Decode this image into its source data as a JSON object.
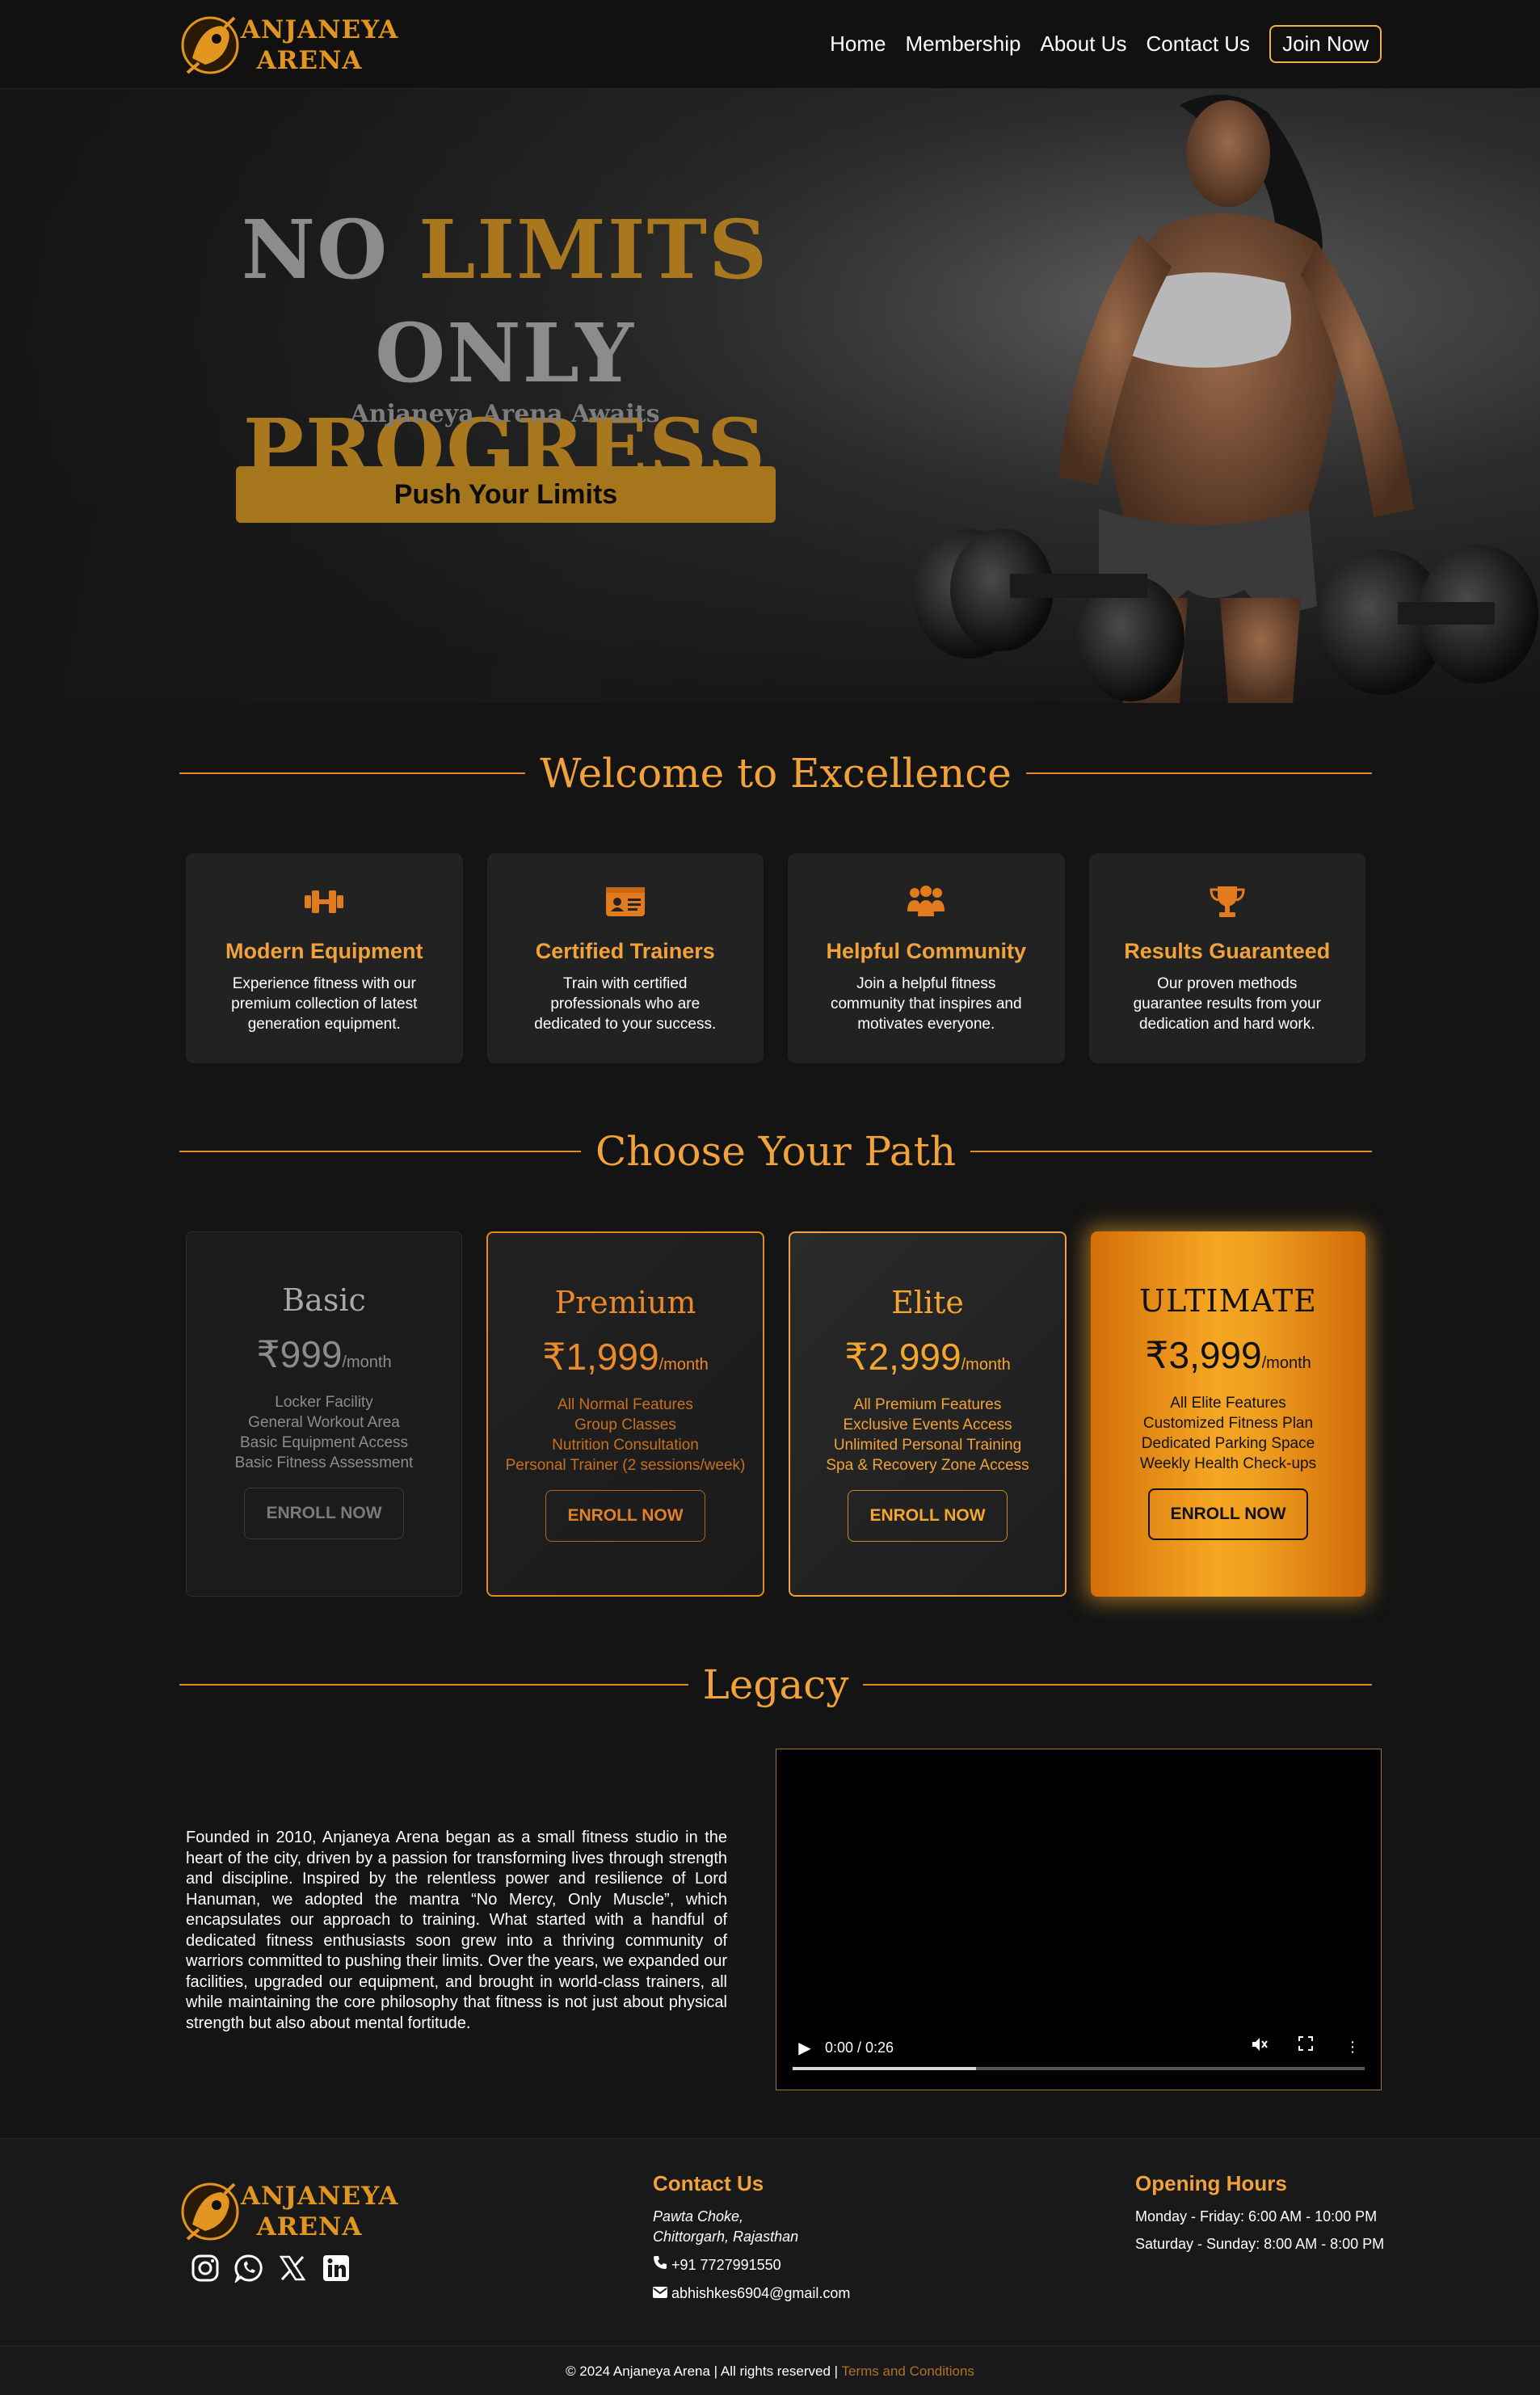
{
  "brand": {
    "line1": "ANJANEYA",
    "line2": "ARENA"
  },
  "nav": {
    "links": [
      "Home",
      "Membership",
      "About Us",
      "Contact Us"
    ],
    "cta": "Join Now"
  },
  "hero": {
    "line1_a": "NO",
    "line1_b": "LIMITS",
    "line2_a": "ONLY",
    "line2_b": "PROGRESS",
    "subtitle": "Anjaneya Arena Awaits",
    "button": "Push Your Limits"
  },
  "welcome": {
    "heading": "Welcome to Excellence",
    "features": [
      {
        "icon": "dumbbell-icon",
        "title": "Modern Equipment",
        "desc": "Experience fitness with our premium collection of latest generation equipment."
      },
      {
        "icon": "id-card-icon",
        "title": "Certified Trainers",
        "desc": "Train with certified professionals who are dedicated to your success."
      },
      {
        "icon": "people-group-icon",
        "title": "Helpful Community",
        "desc": "Join a helpful fitness community that inspires and motivates everyone."
      },
      {
        "icon": "trophy-icon",
        "title": "Results Guaranteed",
        "desc": "Our proven methods guarantee results from your dedication and hard work."
      }
    ]
  },
  "plans": {
    "heading": "Choose Your Path",
    "items": [
      {
        "name": "Basic",
        "price": "₹999",
        "per": "/month",
        "features": [
          "Locker Facility",
          "General Workout Area",
          "Basic Equipment Access",
          "Basic Fitness Assessment"
        ],
        "button": "ENROLL NOW"
      },
      {
        "name": "Premium",
        "price": "₹1,999",
        "per": "/month",
        "features": [
          "All Normal Features",
          "Group Classes",
          "Nutrition Consultation",
          "Personal Trainer (2 sessions/week)"
        ],
        "button": "ENROLL NOW"
      },
      {
        "name": "Elite",
        "price": "₹2,999",
        "per": "/month",
        "features": [
          "All Premium Features",
          "Exclusive Events Access",
          "Unlimited Personal Training",
          "Spa & Recovery Zone Access"
        ],
        "button": "ENROLL NOW"
      },
      {
        "name": "ULTIMATE",
        "price": "₹3,999",
        "per": "/month",
        "features": [
          "All Elite Features",
          "Customized Fitness Plan",
          "Dedicated Parking Space",
          "Weekly Health Check-ups"
        ],
        "button": "ENROLL NOW"
      }
    ]
  },
  "legacy": {
    "heading": "Legacy",
    "text": "Founded in 2010, Anjaneya Arena began as a small fitness studio in the heart of the city, driven by a passion for transforming lives through strength and discipline. Inspired by the relentless power and resilience of Lord Hanuman, we adopted the mantra “No Mercy, Only Muscle”, which encapsulates our approach to training. What started with a handful of dedicated fitness enthusiasts soon grew into a thriving community of warriors committed to pushing their limits. Over the years, we expanded our facilities, upgraded our equipment, and brought in world-class trainers, all while maintaining the core philosophy that fitness is not just about physical strength but also about mental fortitude.",
    "video_time": "0:00 / 0:26",
    "video_progress": 0.32
  },
  "footer": {
    "contact_heading": "Contact Us",
    "address_line1": "Pawta Choke,",
    "address_line2": "Chittorgarh, Rajasthan",
    "phone": "+91 7727991550",
    "email": "abhishkes6904@gmail.com",
    "hours_heading": "Opening Hours",
    "hours_weekday": "Monday - Friday: 6:00 AM - 10:00 PM",
    "hours_weekend": "Saturday - Sunday: 8:00 AM - 8:00 PM",
    "copyright": "© 2024 Anjaneya Arena | All rights reserved |",
    "terms": "Terms and Conditions",
    "socials": [
      "instagram-icon",
      "whatsapp-icon",
      "x-icon",
      "linkedin-icon"
    ]
  },
  "colors": {
    "accent": "#f2a23a",
    "accent_dark": "#e28a1e",
    "bg": "#141414",
    "card": "#222222"
  }
}
